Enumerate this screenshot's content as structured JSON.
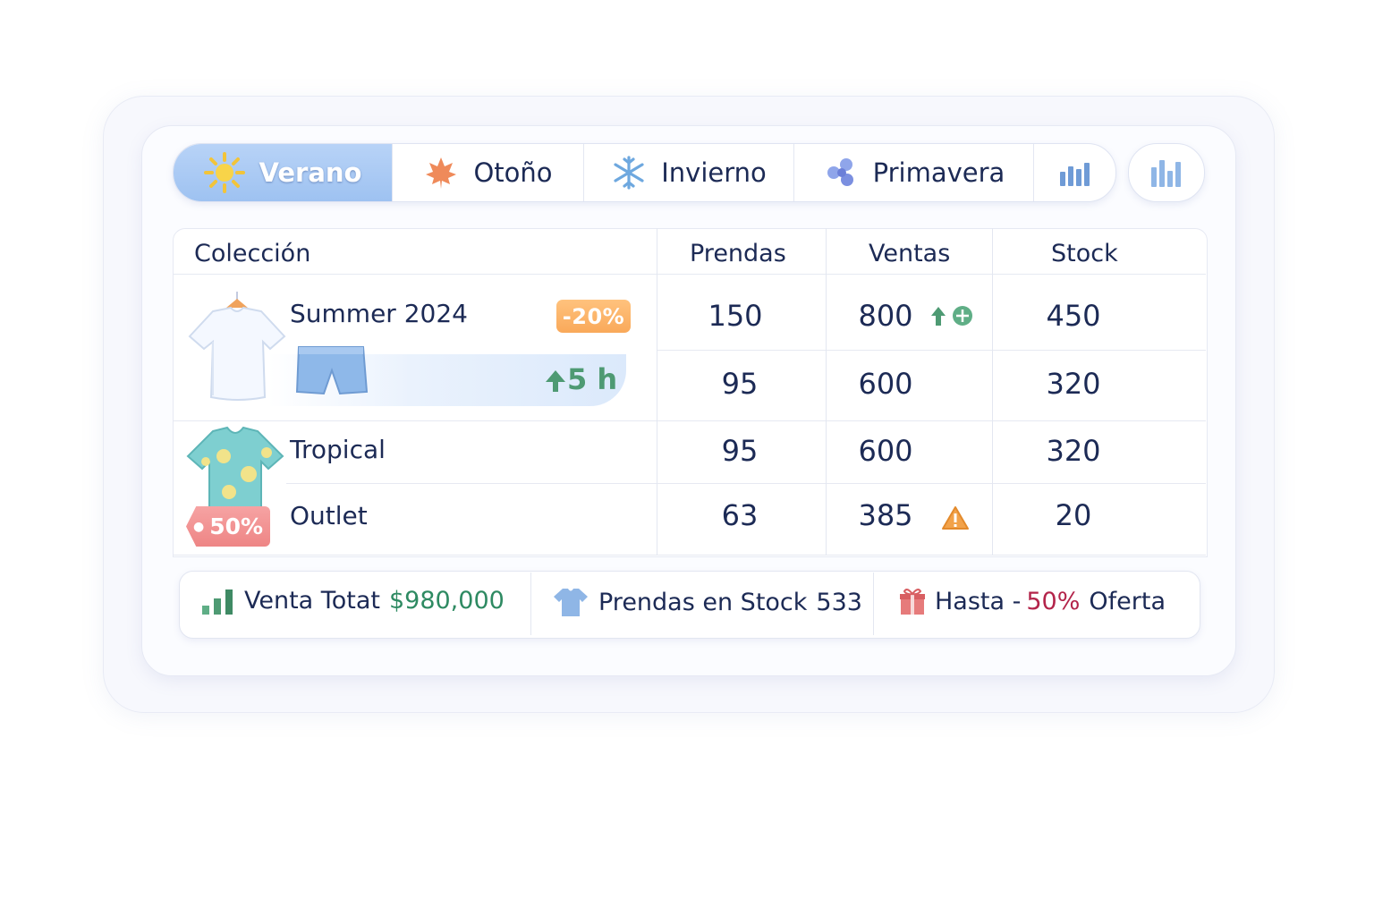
{
  "tabs": [
    {
      "label": "Verano",
      "icon": "sun-icon",
      "active": true
    },
    {
      "label": "Otoño",
      "icon": "maple-leaf-icon",
      "active": false
    },
    {
      "label": "Invierno",
      "icon": "snowflake-icon",
      "active": false
    },
    {
      "label": "Primavera",
      "icon": "flower-icon",
      "active": false
    }
  ],
  "table": {
    "headers": [
      "Colección",
      "Prendas",
      "Ventas",
      "Stock"
    ],
    "rows": [
      {
        "name": "Summer 2024",
        "prendas": "150",
        "ventas": "800",
        "stock": "450",
        "badge": "-20%",
        "trend_icon": "trend-up-icon"
      },
      {
        "name": "",
        "prendas": "95",
        "ventas": "600",
        "stock": "320",
        "timer": "5 h"
      },
      {
        "name": "Tropical",
        "prendas": "95",
        "ventas": "600",
        "stock": "320"
      },
      {
        "name": "Outlet",
        "prendas": "63",
        "ventas": "385",
        "stock": "20",
        "badge": "50%",
        "alert_icon": "warning-icon"
      }
    ]
  },
  "footer": {
    "sales_label": "Venta Totat",
    "sales_value": "$980,000",
    "stock_label": "Prendas en Stock",
    "stock_value": "533",
    "offer_prefix": "Hasta -",
    "offer_value": "50%",
    "offer_suffix": "Oferta"
  },
  "colors": {
    "accent": "#9ec2f1",
    "green": "#2e8a62",
    "red": "#b3244a",
    "orange": "#f9a95a"
  }
}
